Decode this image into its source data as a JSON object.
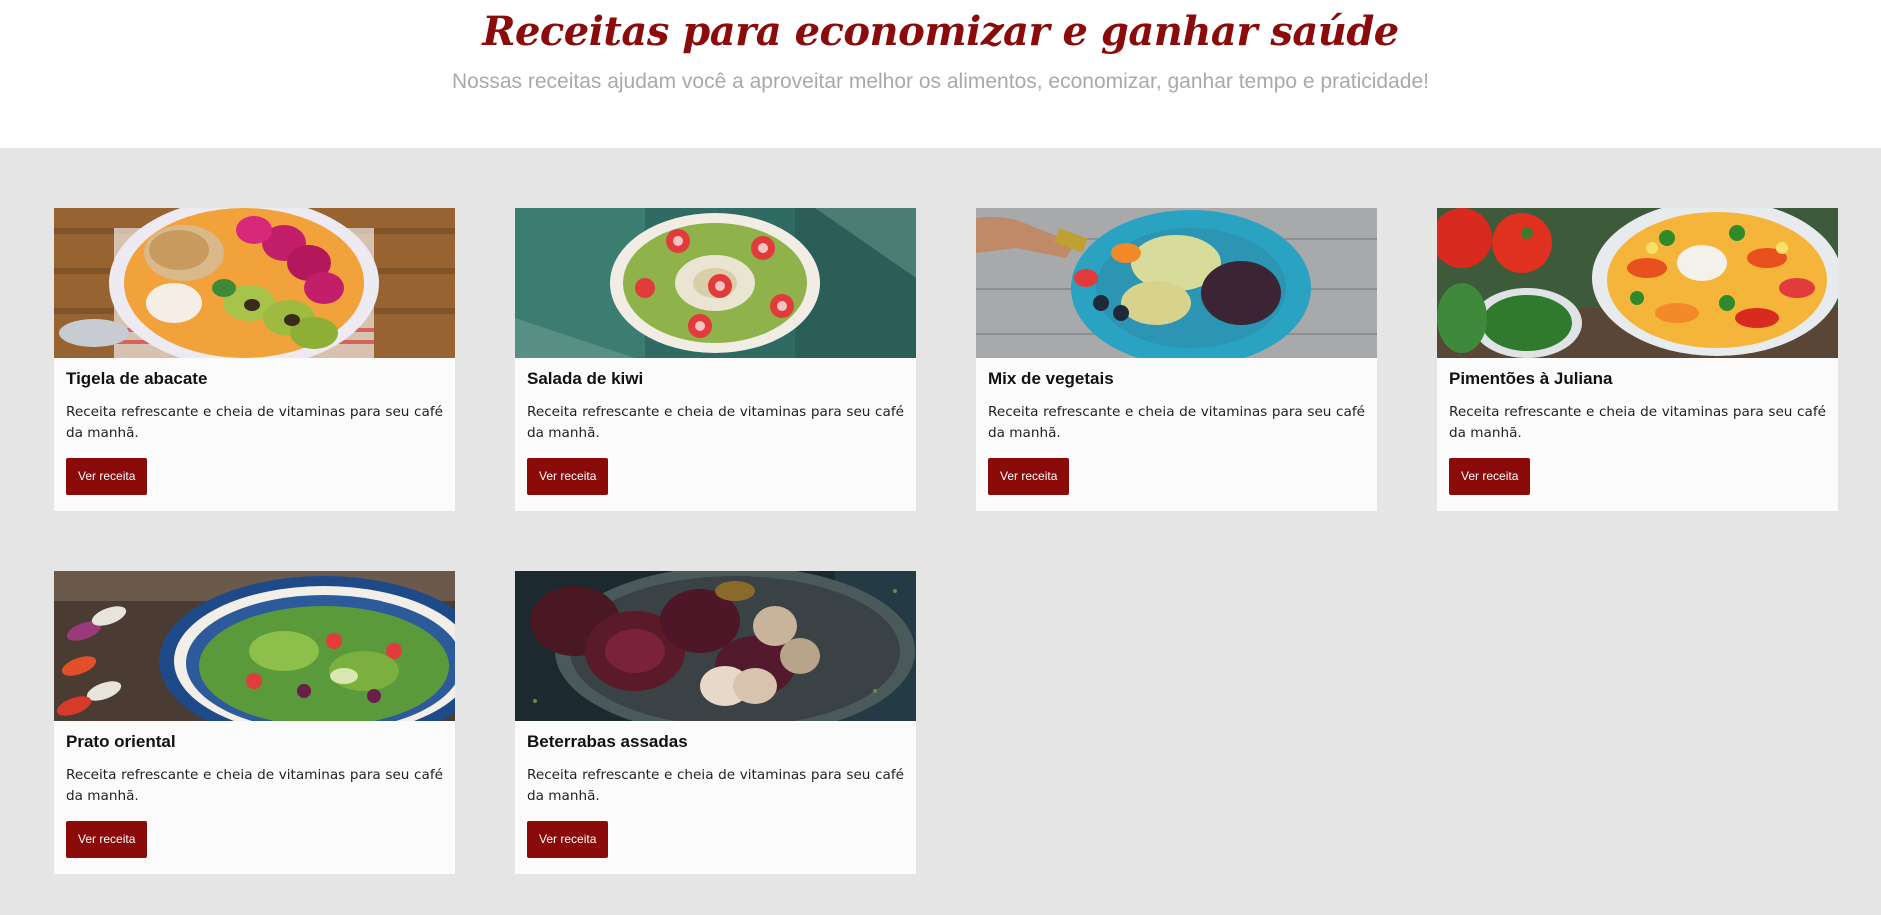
{
  "header": {
    "title": "Receitas para economizar e ganhar saúde",
    "subtitle": "Nossas receitas ajudam você a aproveitar melhor os alimentos, economizar, ganhar tempo e praticidade!"
  },
  "colors": {
    "accent": "#8b0a0a",
    "page_background": "#e5e5e5",
    "card_background": "#fbfbfb"
  },
  "recipes": [
    {
      "title": "Tigela de abacate",
      "description": "Receita refrescante e cheia de vitaminas para seu café da manhã.",
      "button_label": "Ver receita",
      "image": "avocado-bowl-photo"
    },
    {
      "title": "Salada de kiwi",
      "description": "Receita refrescante e cheia de vitaminas para seu café da manhã.",
      "button_label": "Ver receita",
      "image": "kiwi-bowl-photo"
    },
    {
      "title": "Mix de vegetais",
      "description": "Receita refrescante e cheia de vitaminas para seu café da manhã.",
      "button_label": "Ver receita",
      "image": "vegetable-mix-photo"
    },
    {
      "title": "Pimentões à Juliana",
      "description": "Receita refrescante e cheia de vitaminas para seu café da manhã.",
      "button_label": "Ver receita",
      "image": "peppers-photo"
    },
    {
      "title": "Prato oriental",
      "description": "Receita refrescante e cheia de vitaminas para seu café da manhã.",
      "button_label": "Ver receita",
      "image": "oriental-salad-photo"
    },
    {
      "title": "Beterrabas assadas",
      "description": "Receita refrescante e cheia de vitaminas para seu café da manhã.",
      "button_label": "Ver receita",
      "image": "roasted-beets-photo"
    }
  ]
}
